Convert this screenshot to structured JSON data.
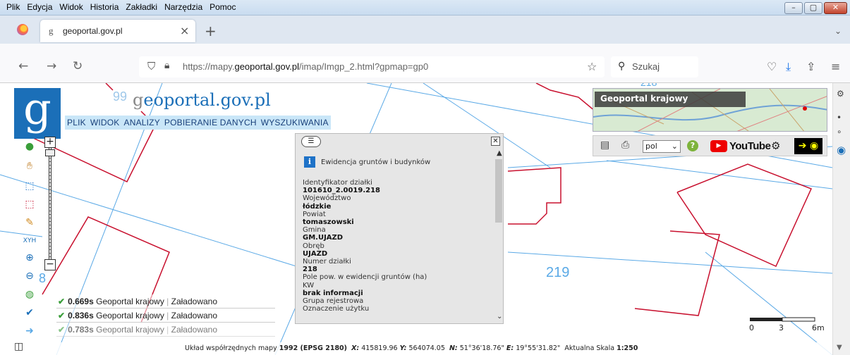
{
  "window": {
    "menu": [
      "Plik",
      "Edycja",
      "Widok",
      "Historia",
      "Zakładki",
      "Narzędzia",
      "Pomoc"
    ]
  },
  "tabs": {
    "favicon": "g",
    "active_title": "geoportal.gov.pl",
    "close": "×",
    "new_tab": "+"
  },
  "navbar": {
    "url_prefix": "https://mapy.",
    "url_domain": "geoportal.gov.pl",
    "url_suffix": "/imap/Imgp_2.html?gpmap=gp0",
    "search_placeholder": "Szukaj"
  },
  "geoportal": {
    "logo_letter": "g",
    "logo_text_g": "g",
    "logo_text_rest": "eoportal.gov.pl",
    "menu": [
      "PLIK",
      "WIDOK",
      "ANALIZY",
      "POBIERANIE DANYCH",
      "WYSZUKIWANIA"
    ],
    "thumbnail_title": "Geoportal krajowy",
    "language": "pol",
    "youtube": "YouTube",
    "help": "?"
  },
  "map_labels": {
    "parcel_219": "219",
    "parcel_218_top": "218",
    "left_num_top": "99",
    "left_num_bottom": "8"
  },
  "popup": {
    "heading": "Ewidencja gruntów i budynków",
    "fields": [
      {
        "label": "Identyfikator działki",
        "value": "101610_2.0019.218"
      },
      {
        "label": "Województwo",
        "value": "łódzkie"
      },
      {
        "label": "Powiat",
        "value": "tomaszowski"
      },
      {
        "label": "Gmina",
        "value": "GM.UJAZD"
      },
      {
        "label": "Obręb",
        "value": "UJAZD"
      },
      {
        "label": "Numer działki",
        "value": "218"
      },
      {
        "label": "Pole pow. w ewidencji gruntów (ha)",
        "value": ""
      },
      {
        "label": "KW",
        "value": "brak informacji"
      },
      {
        "label": "Grupa rejestrowa",
        "value": ""
      },
      {
        "label": "Oznaczenie użytku",
        "value": ""
      }
    ]
  },
  "load_log": [
    {
      "time": "0.669s",
      "source": "Geoportal krajowy",
      "status": "Załadowano"
    },
    {
      "time": "0.836s",
      "source": "Geoportal krajowy",
      "status": "Załadowano"
    },
    {
      "time": "0.783s",
      "source": "Geoportal krajowy",
      "status": "Załadowano"
    }
  ],
  "scale_bar": {
    "start": "0",
    "mid": "3",
    "end": "6m"
  },
  "status": {
    "crs_label": "Układ współrzędnych mapy",
    "crs_value": "1992 (EPSG 2180)",
    "x_label": "X:",
    "x_value": "415819.96",
    "y_label": "Y:",
    "y_value": "564074.05",
    "n_label": "N:",
    "n_value": "51°36'18.76\"",
    "e_label": "E:",
    "e_value": "19°55'31.82\"",
    "scale_label": "Aktualna Skala",
    "scale_value": "1:250"
  },
  "colors": {
    "parcel_red": "#c8102e",
    "grid_blue": "#5aa9e6",
    "logo_blue": "#1b6fb8",
    "menu_bg": "#c9e6f8"
  }
}
